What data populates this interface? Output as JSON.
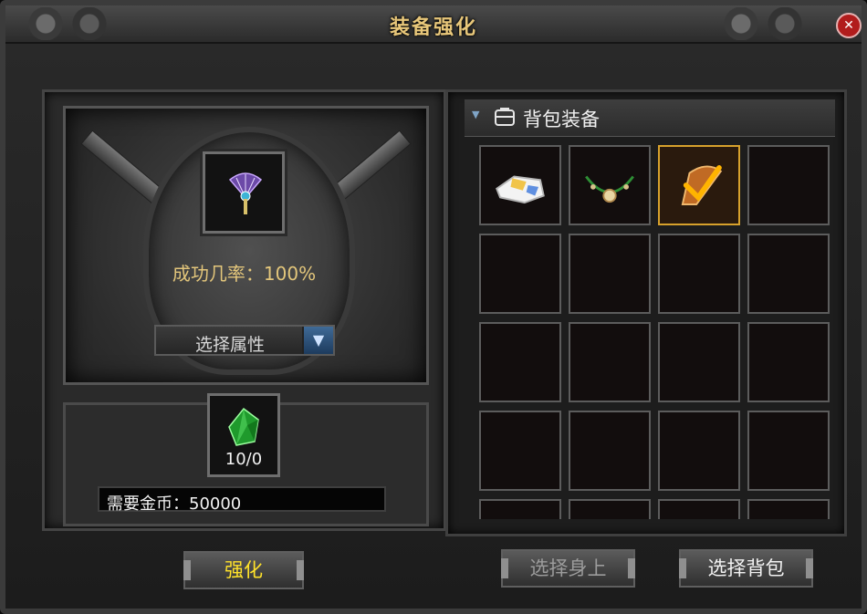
{
  "window": {
    "title": "装备强化"
  },
  "forge": {
    "success_rate_label": "成功几率：",
    "success_rate_value": "100%",
    "attribute_select_label": "选择属性",
    "material_count": "10/0",
    "gold_label": "需要金币：",
    "gold_value": "50000"
  },
  "bag": {
    "title": "背包装备",
    "items": [
      {
        "name": "white-gold-ingot-item",
        "selected": false
      },
      {
        "name": "necklace-item",
        "selected": false
      },
      {
        "name": "fan-item",
        "selected": true
      },
      {
        "name": "",
        "selected": false
      }
    ]
  },
  "buttons": {
    "strengthen": "强化",
    "select_self": "选择身上",
    "select_bag": "选择背包"
  },
  "colors": {
    "title": "#e8c77a",
    "success_text": "#e3c67b",
    "strengthen_text": "#ffe22a",
    "selected_border": "#d7a12c",
    "close_button": "#b11c1c"
  }
}
